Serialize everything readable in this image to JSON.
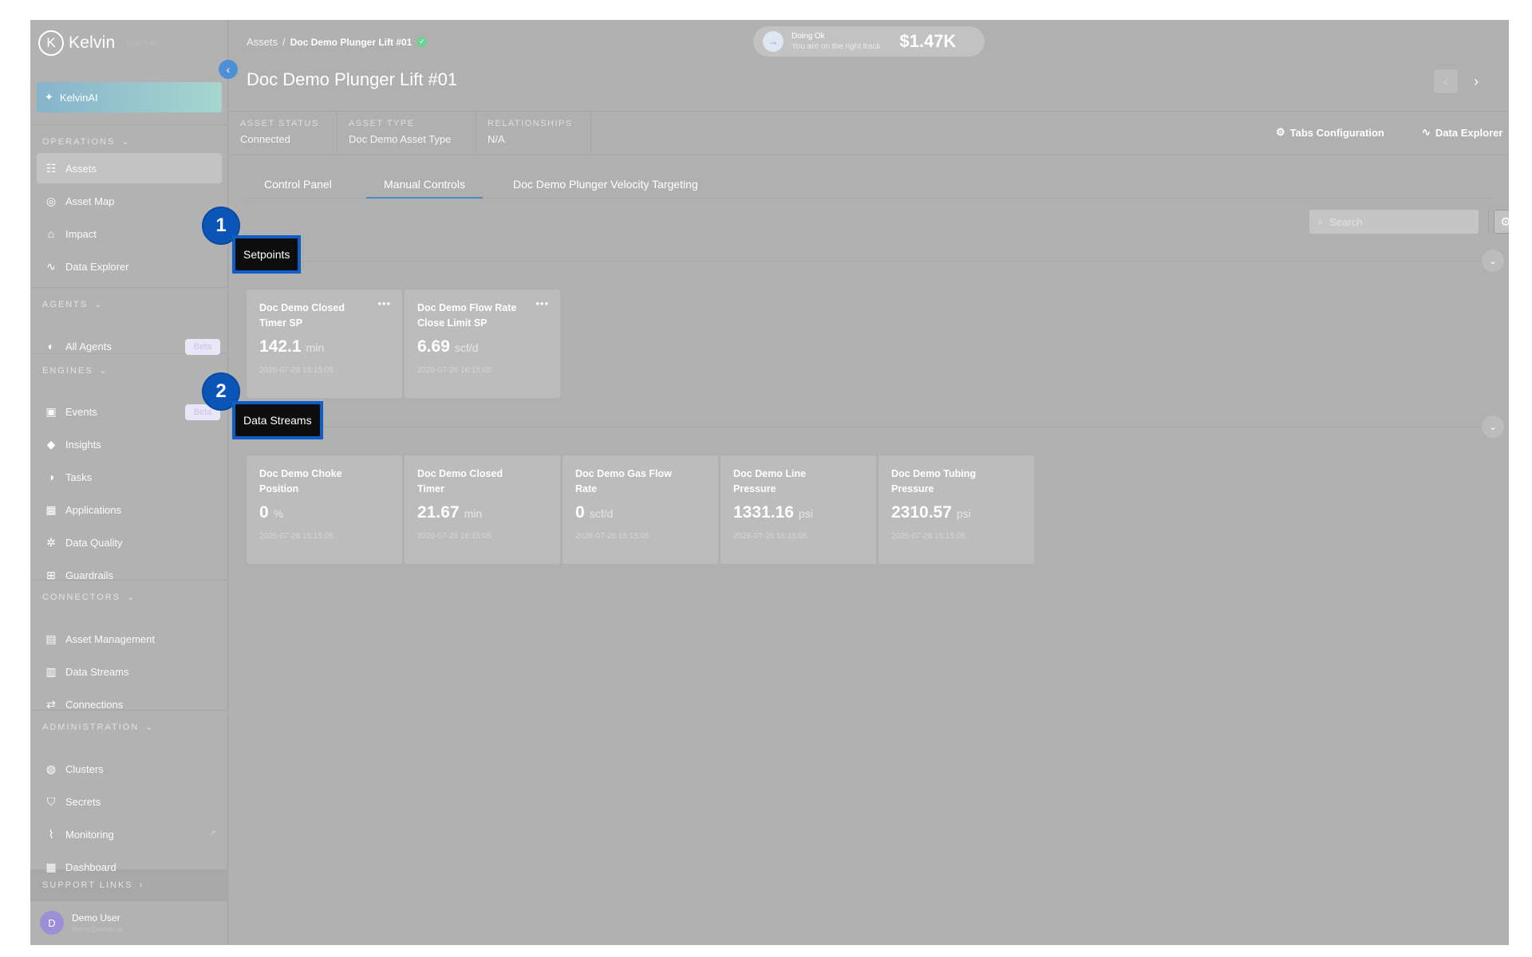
{
  "brand": {
    "name": "Kelvin",
    "sub": "Kelvin AI",
    "logo_glyph": "K"
  },
  "kelvin_ai_button": "KelvinAI",
  "sidebar": {
    "sections": [
      {
        "title": "OPERATIONS",
        "items": [
          {
            "label": "Assets",
            "icon": "assets-icon",
            "glyph": "☷",
            "active": true
          },
          {
            "label": "Asset Map",
            "icon": "globe-icon",
            "glyph": "◎"
          },
          {
            "label": "Impact",
            "icon": "impact-icon",
            "glyph": "⌂"
          },
          {
            "label": "Data Explorer",
            "icon": "pulse-icon",
            "glyph": "∿"
          }
        ]
      },
      {
        "title": "AGENTS",
        "items": [
          {
            "label": "All Agents",
            "icon": "agent-icon",
            "glyph": "◐",
            "badge": "Beta"
          }
        ]
      },
      {
        "title": "ENGINES",
        "items": [
          {
            "label": "Events",
            "icon": "events-icon",
            "glyph": "▣",
            "badge": "Beta"
          },
          {
            "label": "Insights",
            "icon": "tag-icon",
            "glyph": "◆"
          },
          {
            "label": "Tasks",
            "icon": "tasks-icon",
            "glyph": "◑"
          },
          {
            "label": "Applications",
            "icon": "apps-icon",
            "glyph": "▦"
          },
          {
            "label": "Data Quality",
            "icon": "gear-icon",
            "glyph": "✲"
          },
          {
            "label": "Guardrails",
            "icon": "guardrails-icon",
            "glyph": "⊞"
          }
        ]
      },
      {
        "title": "CONNECTORS",
        "items": [
          {
            "label": "Asset Management",
            "icon": "asset-mgmt-icon",
            "glyph": "▤"
          },
          {
            "label": "Data Streams",
            "icon": "streams-icon",
            "glyph": "▥"
          },
          {
            "label": "Connections",
            "icon": "connections-icon",
            "glyph": "⇄"
          }
        ]
      },
      {
        "title": "ADMINISTRATION",
        "items": [
          {
            "label": "Clusters",
            "icon": "clusters-icon",
            "glyph": "◍"
          },
          {
            "label": "Secrets",
            "icon": "shield-icon",
            "glyph": "⛉"
          },
          {
            "label": "Monitoring",
            "icon": "monitoring-icon",
            "glyph": "⌇",
            "external": true
          },
          {
            "label": "Dashboard",
            "icon": "dashboard-icon",
            "glyph": "▦"
          }
        ]
      }
    ],
    "support": "SUPPORT LINKS",
    "user": {
      "initial": "D",
      "name": "Demo User",
      "email": "demo@kelvin.ai"
    }
  },
  "header": {
    "breadcrumb_root": "Assets",
    "breadcrumb_sep": "/",
    "breadcrumb_current": "Doc Demo Plunger Lift #01",
    "title": "Doc Demo Plunger Lift #01",
    "status_pill": {
      "title": "Doing Ok",
      "subtitle": "You are on the right track",
      "amount": "$1.47K"
    }
  },
  "info_bar": {
    "cells": [
      {
        "label": "ASSET STATUS",
        "value": "Connected"
      },
      {
        "label": "ASSET TYPE",
        "value": "Doc Demo Asset Type"
      },
      {
        "label": "RELATIONSHIPS",
        "value": "N/A"
      }
    ],
    "tabs_config": "Tabs Configuration",
    "data_explorer": "Data Explorer"
  },
  "tabs": [
    {
      "label": "Control Panel"
    },
    {
      "label": "Manual Controls",
      "active": true
    },
    {
      "label": "Doc Demo Plunger Velocity Targeting"
    }
  ],
  "search": {
    "placeholder": "Search"
  },
  "sections": [
    {
      "badge": "1",
      "title": "Setpoints",
      "cards": [
        {
          "name": "Doc Demo Closed Timer SP",
          "value": "142.1",
          "unit": "min",
          "ts": "2026-07-26 16:15:05",
          "menu": true
        },
        {
          "name": "Doc Demo Flow Rate Close Limit SP",
          "value": "6.69",
          "unit": "scf/d",
          "ts": "2026-07-26 16:15:05",
          "menu": true
        }
      ]
    },
    {
      "badge": "2",
      "title": "Data Streams",
      "cards": [
        {
          "name": "Doc Demo Choke Position",
          "value": "0",
          "unit": "%",
          "ts": "2026-07-26 16:15:05"
        },
        {
          "name": "Doc Demo Closed Timer",
          "value": "21.67",
          "unit": "min",
          "ts": "2026-07-26 16:15:05"
        },
        {
          "name": "Doc Demo Gas Flow Rate",
          "value": "0",
          "unit": "scf/d",
          "ts": "2026-07-26 16:15:05"
        },
        {
          "name": "Doc Demo Line Pressure",
          "value": "1331.16",
          "unit": "psi",
          "ts": "2026-07-26 16:15:05"
        },
        {
          "name": "Doc Demo Tubing Pressure",
          "value": "2310.57",
          "unit": "psi",
          "ts": "2026-07-26 16:15:05"
        }
      ]
    }
  ],
  "colors": {
    "highlight": "#0f5ec7",
    "tab_active": "#4c87c9",
    "badge": "#0b55b8"
  }
}
